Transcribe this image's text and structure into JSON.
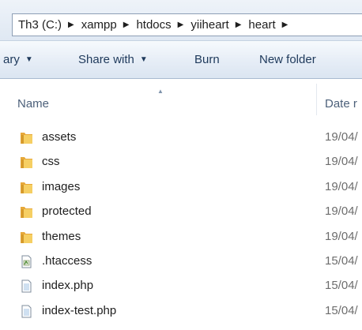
{
  "address_bar": {
    "crumbs": [
      "Th3 (C:)",
      "xampp",
      "htdocs",
      "yiiheart",
      "heart"
    ]
  },
  "toolbar": {
    "library_label": "ary",
    "share_label": "Share with",
    "burn_label": "Burn",
    "new_folder_label": "New folder"
  },
  "columns": {
    "name": "Name",
    "date": "Date r"
  },
  "files": [
    {
      "name": "assets",
      "date": "19/04/",
      "icon": "folder-icon"
    },
    {
      "name": "css",
      "date": "19/04/",
      "icon": "folder-icon"
    },
    {
      "name": "images",
      "date": "19/04/",
      "icon": "folder-icon"
    },
    {
      "name": "protected",
      "date": "19/04/",
      "icon": "folder-icon"
    },
    {
      "name": "themes",
      "date": "19/04/",
      "icon": "folder-icon"
    },
    {
      "name": ".htaccess",
      "date": "15/04/",
      "icon": "config-file-icon"
    },
    {
      "name": "index.php",
      "date": "15/04/",
      "icon": "file-icon"
    },
    {
      "name": "index-test.php",
      "date": "15/04/",
      "icon": "file-icon"
    }
  ],
  "colors": {
    "toolbar_text": "#1e395b",
    "header_text": "#4c607a",
    "date_text": "#6d6d6d",
    "folder_yellow": "#f2c24e"
  }
}
